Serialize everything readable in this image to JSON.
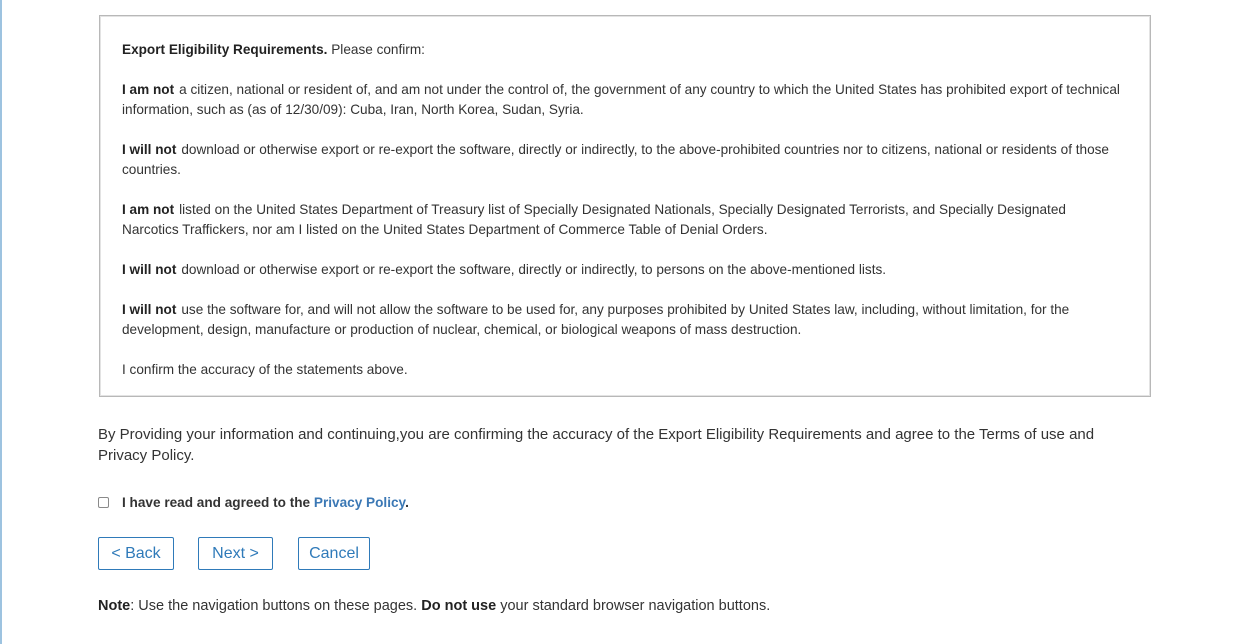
{
  "export_box": {
    "heading_bold": "Export Eligibility Requirements.",
    "heading_rest": "Please confirm:",
    "items": [
      {
        "bold": "I am not",
        "text": "a citizen, national or resident of, and am not under the control of, the government of any country to which the United States has prohibited export of technical information, such as (as of 12/30/09): Cuba, Iran, North Korea, Sudan, Syria."
      },
      {
        "bold": "I will not",
        "text": "download or otherwise export or re-export the software, directly or indirectly, to the above-prohibited countries nor to citizens, national or residents of those countries."
      },
      {
        "bold": "I am not",
        "text": "listed on the United States Department of Treasury list of Specially Designated Nationals, Specially Designated Terrorists, and Specially Designated Narcotics Traffickers, nor am I listed on the United States Department of Commerce Table of Denial Orders."
      },
      {
        "bold": "I will not",
        "text": "download or otherwise export or re-export the software, directly or indirectly, to persons on the above-mentioned lists."
      },
      {
        "bold": "I will not",
        "text": "use the software for, and will not allow the software to be used for, any purposes prohibited by United States law, including, without limitation, for the development, design, manufacture or production of nuclear, chemical, or biological weapons of mass destruction."
      }
    ],
    "confirm_text": "I confirm the accuracy of the statements above."
  },
  "statement": "By Providing your information and continuing,you are confirming the accuracy of the Export Eligibility Requirements and agree to the Terms of use and Privacy Policy.",
  "agreement": {
    "checked": false,
    "label_prefix": "I have read and agreed to the",
    "link_text": "Privacy Policy",
    "label_suffix": "."
  },
  "buttons": {
    "back": "< Back",
    "next": "Next >",
    "cancel": "Cancel"
  },
  "note": {
    "label": "Note",
    "text1": ": Use the navigation buttons on these pages.",
    "bold2": "Do not use",
    "text2": "your standard browser navigation buttons."
  },
  "colors": {
    "accent": "#2f7ab9",
    "link": "#3b78b5",
    "border": "#b8b8b8"
  }
}
